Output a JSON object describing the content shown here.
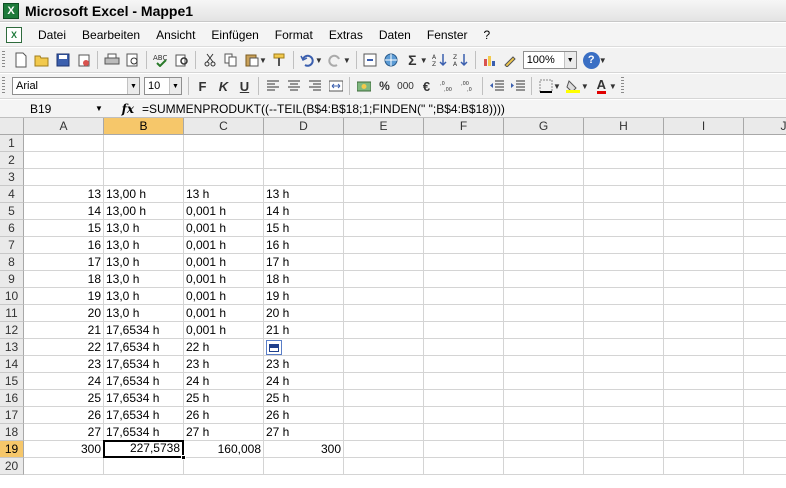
{
  "window": {
    "title": "Microsoft Excel - Mappe1"
  },
  "menu": [
    "Datei",
    "Bearbeiten",
    "Ansicht",
    "Einfügen",
    "Format",
    "Extras",
    "Daten",
    "Fenster",
    "?"
  ],
  "toolbar": {
    "zoom": "100%",
    "font": "Arial",
    "font_size": "10",
    "percent": "%",
    "thousands": "000",
    "euro": "€",
    "sigma": "Σ"
  },
  "formula_bar": {
    "name_box": "B19",
    "fx": "fx",
    "formula": "=SUMMENPRODUKT((--TEIL(B$4:B$18;1;FINDEN(\" \";B$4:B$18))))"
  },
  "sheet": {
    "columns": [
      "A",
      "B",
      "C",
      "D",
      "E",
      "F",
      "G",
      "H",
      "I",
      "J"
    ],
    "active_column": "B",
    "active_row": "19",
    "rows": [
      {
        "n": "1",
        "A": "",
        "B": "",
        "C": "",
        "D": ""
      },
      {
        "n": "2",
        "A": "",
        "B": "",
        "C": "",
        "D": ""
      },
      {
        "n": "3",
        "A": "",
        "B": "",
        "C": "",
        "D": ""
      },
      {
        "n": "4",
        "A": "13",
        "B": "13,00 h",
        "C": "13 h",
        "D": "13 h"
      },
      {
        "n": "5",
        "A": "14",
        "B": "13,00 h",
        "C": "0,001 h",
        "D": "14 h"
      },
      {
        "n": "6",
        "A": "15",
        "B": "13,0 h",
        "C": "0,001 h",
        "D": "15 h"
      },
      {
        "n": "7",
        "A": "16",
        "B": "13,0 h",
        "C": "0,001 h",
        "D": "16 h"
      },
      {
        "n": "8",
        "A": "17",
        "B": "13,0 h",
        "C": "0,001 h",
        "D": "17 h"
      },
      {
        "n": "9",
        "A": "18",
        "B": "13,0 h",
        "C": "0,001 h",
        "D": "18 h"
      },
      {
        "n": "10",
        "A": "19",
        "B": "13,0 h",
        "C": "0,001 h",
        "D": "19 h"
      },
      {
        "n": "11",
        "A": "20",
        "B": "13,0 h",
        "C": "0,001 h",
        "D": "20 h"
      },
      {
        "n": "12",
        "A": "21",
        "B": "17,6534 h",
        "C": "0,001 h",
        "D": "21 h"
      },
      {
        "n": "13",
        "A": "22",
        "B": "17,6534 h",
        "C": "22 h",
        "D": "h"
      },
      {
        "n": "14",
        "A": "23",
        "B": "17,6534 h",
        "C": "23 h",
        "D": "23 h"
      },
      {
        "n": "15",
        "A": "24",
        "B": "17,6534 h",
        "C": "24 h",
        "D": "24 h"
      },
      {
        "n": "16",
        "A": "25",
        "B": "17,6534 h",
        "C": "25 h",
        "D": "25 h"
      },
      {
        "n": "17",
        "A": "26",
        "B": "17,6534 h",
        "C": "26 h",
        "D": "26 h"
      },
      {
        "n": "18",
        "A": "27",
        "B": "17,6534 h",
        "C": "27 h",
        "D": "27 h"
      },
      {
        "n": "19",
        "A": "300",
        "B": "227,5738",
        "C": "160,008",
        "D": "300"
      },
      {
        "n": "20",
        "A": "",
        "B": "",
        "C": "",
        "D": ""
      }
    ]
  }
}
